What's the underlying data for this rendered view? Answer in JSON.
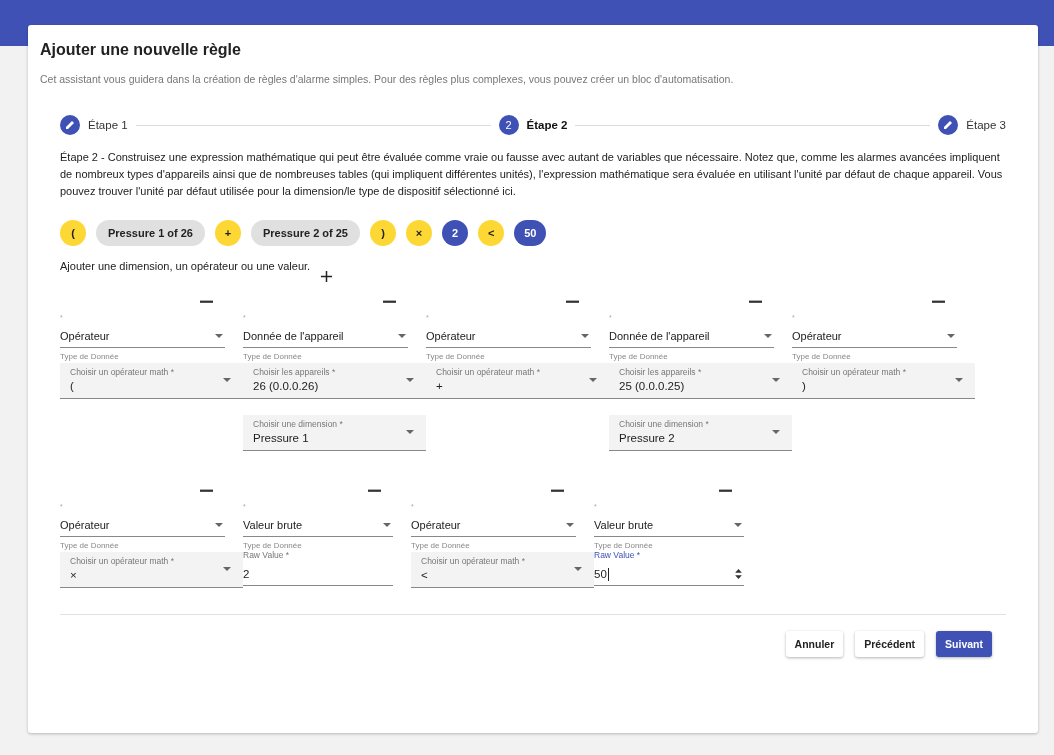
{
  "title": "Ajouter une nouvelle règle",
  "subtitle": "Cet assistant vous guidera dans la création de règles d'alarme simples. Pour des règles plus complexes, vous pouvez créer un bloc d'automatisation.",
  "steps": [
    {
      "label": "Étape 1",
      "kind": "edit",
      "selected": false
    },
    {
      "label": "Étape 2",
      "kind": "number",
      "number": "2",
      "selected": true
    },
    {
      "label": "Étape 3",
      "kind": "edit",
      "selected": false
    }
  ],
  "description": "Étape 2 - Construisez une expression mathématique qui peut être évaluée comme vraie ou fausse avec autant de variables que nécessaire. Notez que, comme les alarmes avancées impliquent de nombreux types d'appareils ainsi que de nombreuses tables (qui impliquent différentes unités), l'expression mathématique sera évaluée en utilisant l'unité par défaut de chaque appareil. Vous pouvez trouver l'unité par défaut utilisée pour la dimension/le type de dispositif sélectionné ici.",
  "chips": [
    {
      "label": "(",
      "kind": "operator"
    },
    {
      "label": "Pressure 1 of 26",
      "kind": "dimension"
    },
    {
      "label": "+",
      "kind": "operator"
    },
    {
      "label": "Pressure 2 of 25",
      "kind": "dimension"
    },
    {
      "label": ")",
      "kind": "operator"
    },
    {
      "label": "×",
      "kind": "operator"
    },
    {
      "label": "2",
      "kind": "value"
    },
    {
      "label": "<",
      "kind": "operator"
    },
    {
      "label": "50",
      "kind": "value"
    }
  ],
  "add_label": "Ajouter une dimension, un opérateur ou une valeur.",
  "rows": [
    [
      {
        "kind": "operator",
        "mark": "*",
        "type_value": "Opérateur",
        "type_hint": "Type de Donnée",
        "fields": [
          {
            "label": "Choisir un opérateur math *",
            "value": "("
          }
        ]
      },
      {
        "kind": "device",
        "mark": "*",
        "type_value": "Donnée de l'appareil",
        "type_hint": "Type de Donnée",
        "fields": [
          {
            "label": "Choisir les appareils *",
            "value": "26 (0.0.0.26)"
          },
          {
            "label": "Choisir une dimension *",
            "value": "Pressure 1"
          }
        ]
      },
      {
        "kind": "operator",
        "mark": "*",
        "type_value": "Opérateur",
        "type_hint": "Type de Donnée",
        "fields": [
          {
            "label": "Choisir un opérateur math *",
            "value": "+"
          }
        ]
      },
      {
        "kind": "device",
        "mark": "*",
        "type_value": "Donnée de l'appareil",
        "type_hint": "Type de Donnée",
        "fields": [
          {
            "label": "Choisir les appareils *",
            "value": "25 (0.0.0.25)"
          },
          {
            "label": "Choisir une dimension *",
            "value": "Pressure 2"
          }
        ]
      },
      {
        "kind": "operator",
        "mark": "*",
        "type_value": "Opérateur",
        "type_hint": "Type de Donnée",
        "fields": [
          {
            "label": "Choisir un opérateur math *",
            "value": ")"
          }
        ]
      }
    ],
    [
      {
        "kind": "operator",
        "mark": "*",
        "type_value": "Opérateur",
        "type_hint": "Type de Donnée",
        "fields": [
          {
            "label": "Choisir un opérateur math *",
            "value": "×"
          }
        ]
      },
      {
        "kind": "raw",
        "mark": "*",
        "type_value": "Valeur brute",
        "type_hint": "Type de Donnée",
        "fields": [
          {
            "label": "Raw Value *",
            "value": "2",
            "focused": false
          }
        ]
      },
      {
        "kind": "operator",
        "mark": "*",
        "type_value": "Opérateur",
        "type_hint": "Type de Donnée",
        "fields": [
          {
            "label": "Choisir un opérateur math *",
            "value": "<"
          }
        ]
      },
      {
        "kind": "raw",
        "mark": "*",
        "type_value": "Valeur brute",
        "type_hint": "Type de Donnée",
        "fields": [
          {
            "label": "Raw Value *",
            "value": "50",
            "focused": true
          }
        ]
      }
    ]
  ],
  "buttons": [
    {
      "label": "Annuler",
      "kind": "plain"
    },
    {
      "label": "Précédent",
      "kind": "plain"
    },
    {
      "label": "Suivant",
      "kind": "primary"
    }
  ]
}
